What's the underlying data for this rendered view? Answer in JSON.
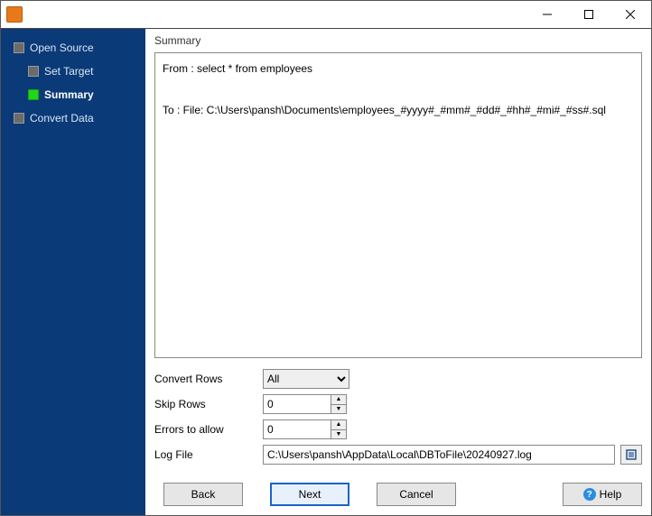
{
  "window": {
    "title": ""
  },
  "sidebar": {
    "steps": [
      {
        "label": "Open Source",
        "current": false
      },
      {
        "label": "Set Target",
        "current": false
      },
      {
        "label": "Summary",
        "current": true
      },
      {
        "label": "Convert Data",
        "current": false
      }
    ]
  },
  "summary": {
    "heading": "Summary",
    "from_line": "From : select * from employees",
    "to_line": "To : File: C:\\Users\\pansh\\Documents\\employees_#yyyy#_#mm#_#dd#_#hh#_#mi#_#ss#.sql"
  },
  "form": {
    "convert_rows": {
      "label": "Convert Rows",
      "value": "All"
    },
    "skip_rows": {
      "label": "Skip Rows",
      "value": "0"
    },
    "errors_allow": {
      "label": "Errors to allow",
      "value": "0"
    },
    "log_file": {
      "label": "Log File",
      "value": "C:\\Users\\pansh\\AppData\\Local\\DBToFile\\20240927.log"
    }
  },
  "buttons": {
    "back": "Back",
    "next": "Next",
    "cancel": "Cancel",
    "help": "Help"
  }
}
